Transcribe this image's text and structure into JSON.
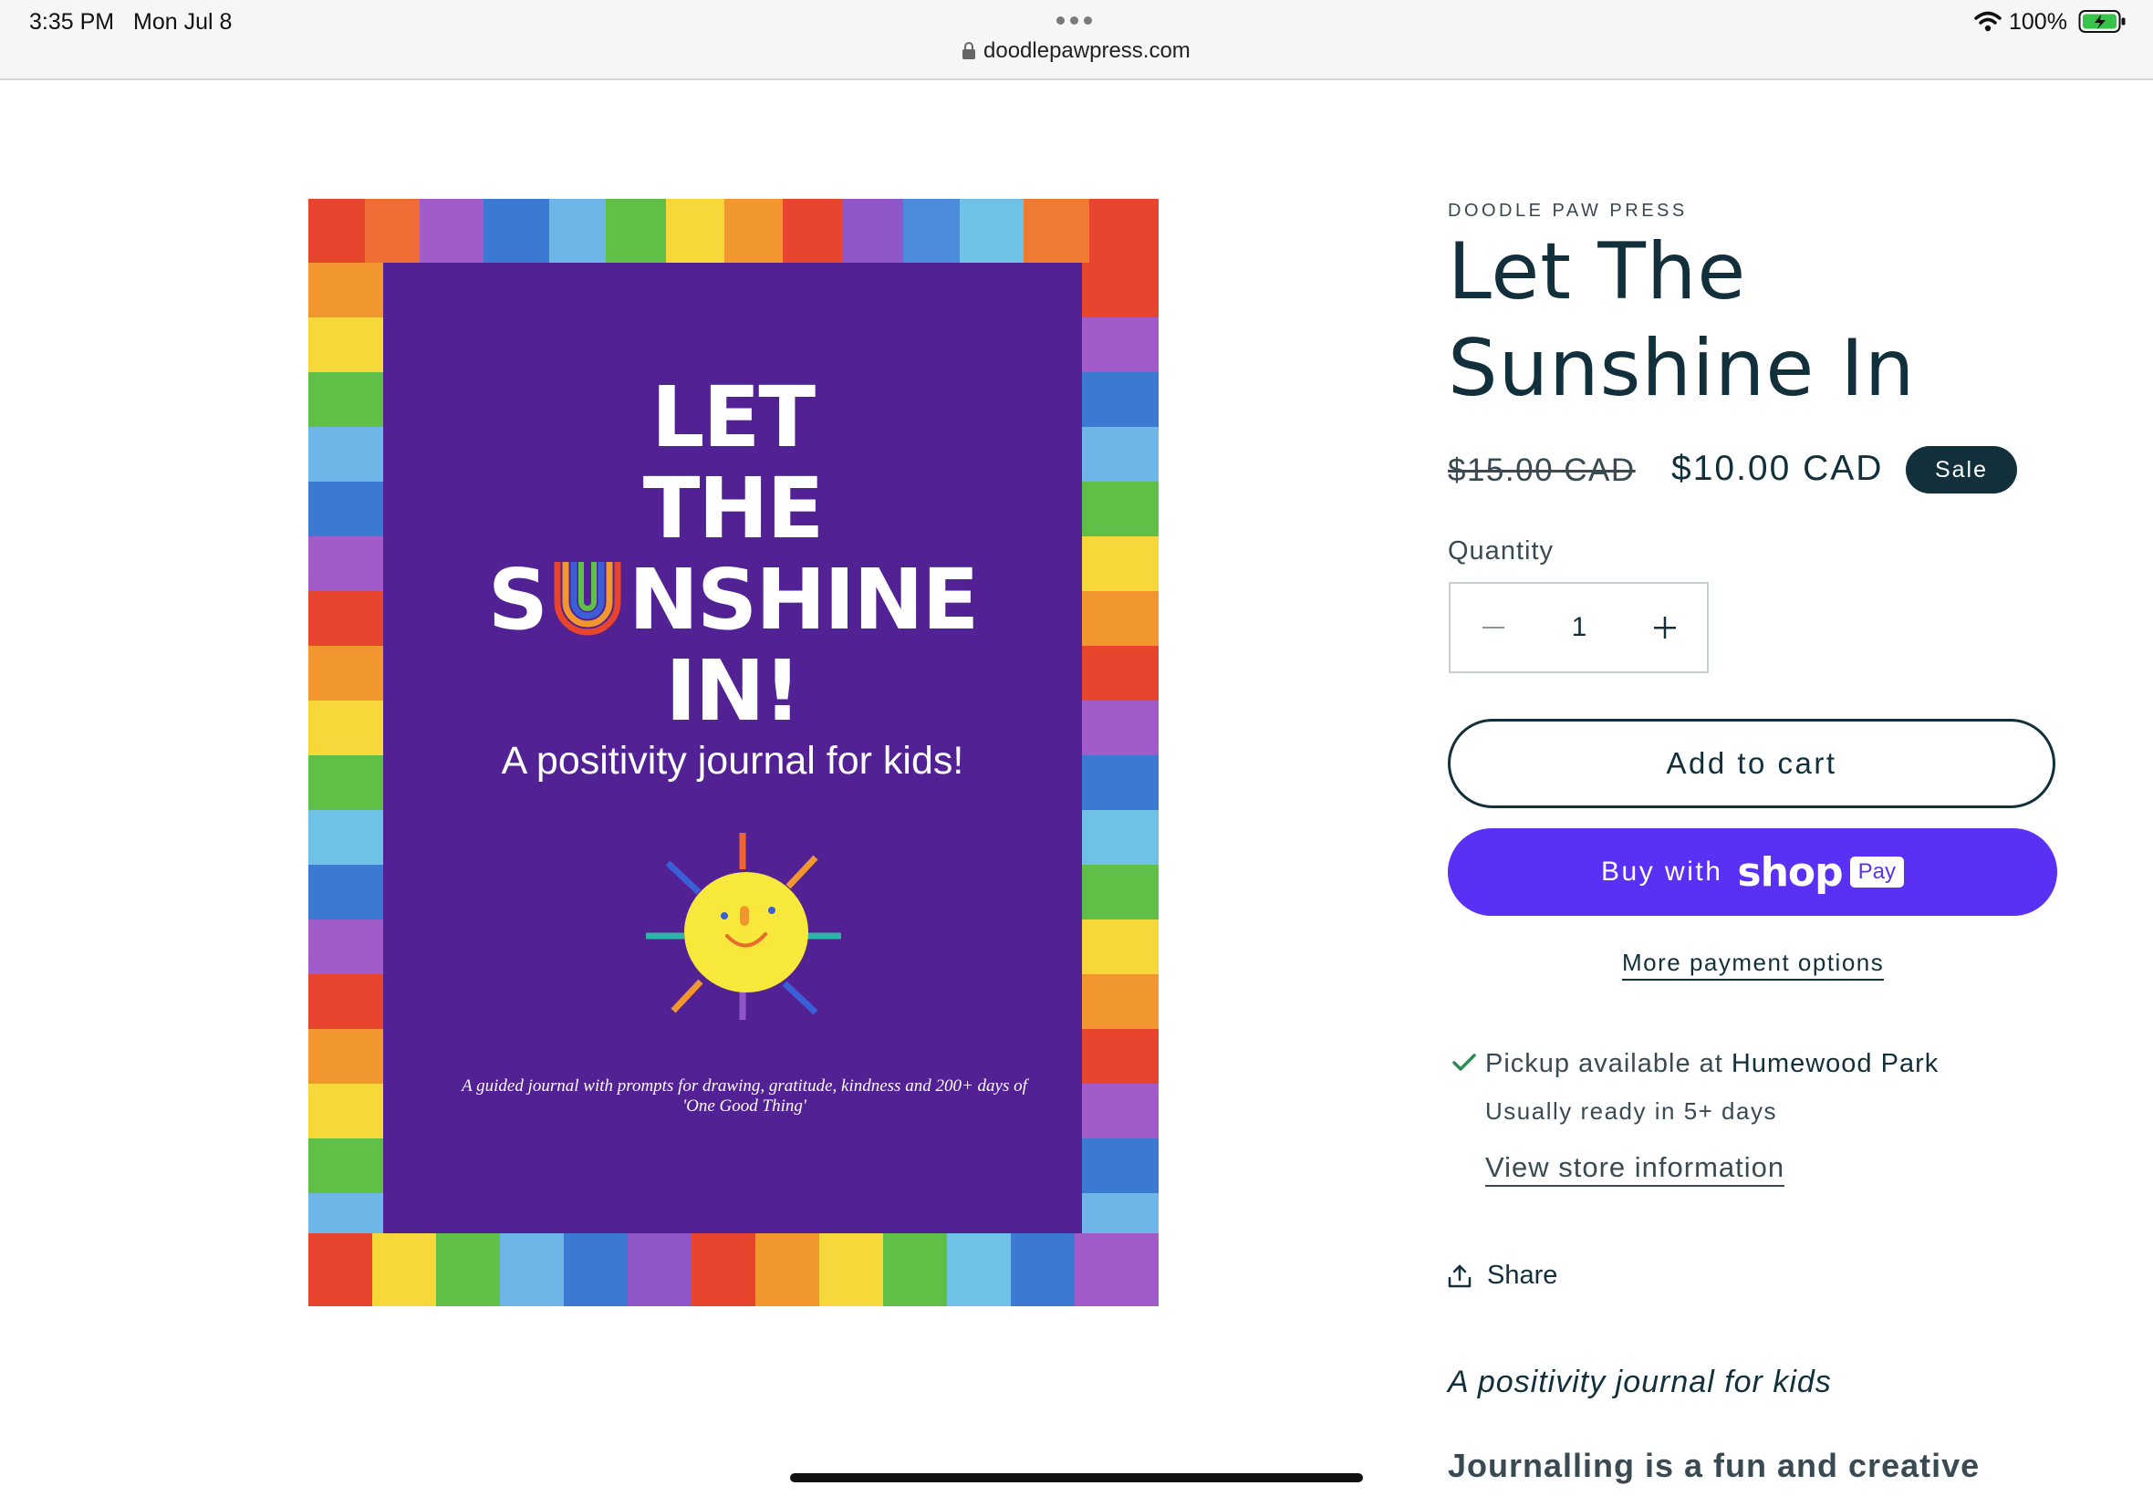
{
  "status": {
    "time": "3:35 PM",
    "date": "Mon Jul 8",
    "url": "doodlepawpress.com",
    "battery": "100%"
  },
  "cover": {
    "title_lines": [
      "LET",
      "THE"
    ],
    "title_sunshine_s": "S",
    "title_sunshine_rest": "NSHINE",
    "title_in": "IN!",
    "subtitle": "A positivity journal for kids!",
    "blurb": "A guided journal with prompts for drawing, gratitude, kindness and 200+ days of 'One Good Thing'"
  },
  "product": {
    "vendor": "DOODLE PAW PRESS",
    "title_line1": "Let The",
    "title_line2": "Sunshine In",
    "price_old": "$15.00 CAD",
    "price_new": "$10.00 CAD",
    "badge": "Sale",
    "quantity_label": "Quantity",
    "quantity_value": "1",
    "add_to_cart": "Add to cart",
    "buy_with": "Buy with",
    "shop_logo": "shop",
    "pay_badge": "Pay",
    "more_payment": "More payment options",
    "pickup_prefix": "Pickup available at ",
    "pickup_location": "Humewood Park",
    "ready_text": "Usually ready in 5+ days",
    "store_info": "View store information",
    "share": "Share",
    "desc_italic": "A positivity journal for kids",
    "desc_bold": "Journalling is a fun and creative"
  },
  "colors": {
    "accent": "#12303c",
    "shop_pay": "#5a31f4",
    "cover_purple": "#522193",
    "sun_yellow": "#f8e83c",
    "check_green": "#2e8b57"
  },
  "icons": [
    "lock-icon",
    "wifi-icon",
    "battery-icon",
    "minus-icon",
    "plus-icon",
    "check-icon",
    "share-icon",
    "more-dots-icon"
  ]
}
